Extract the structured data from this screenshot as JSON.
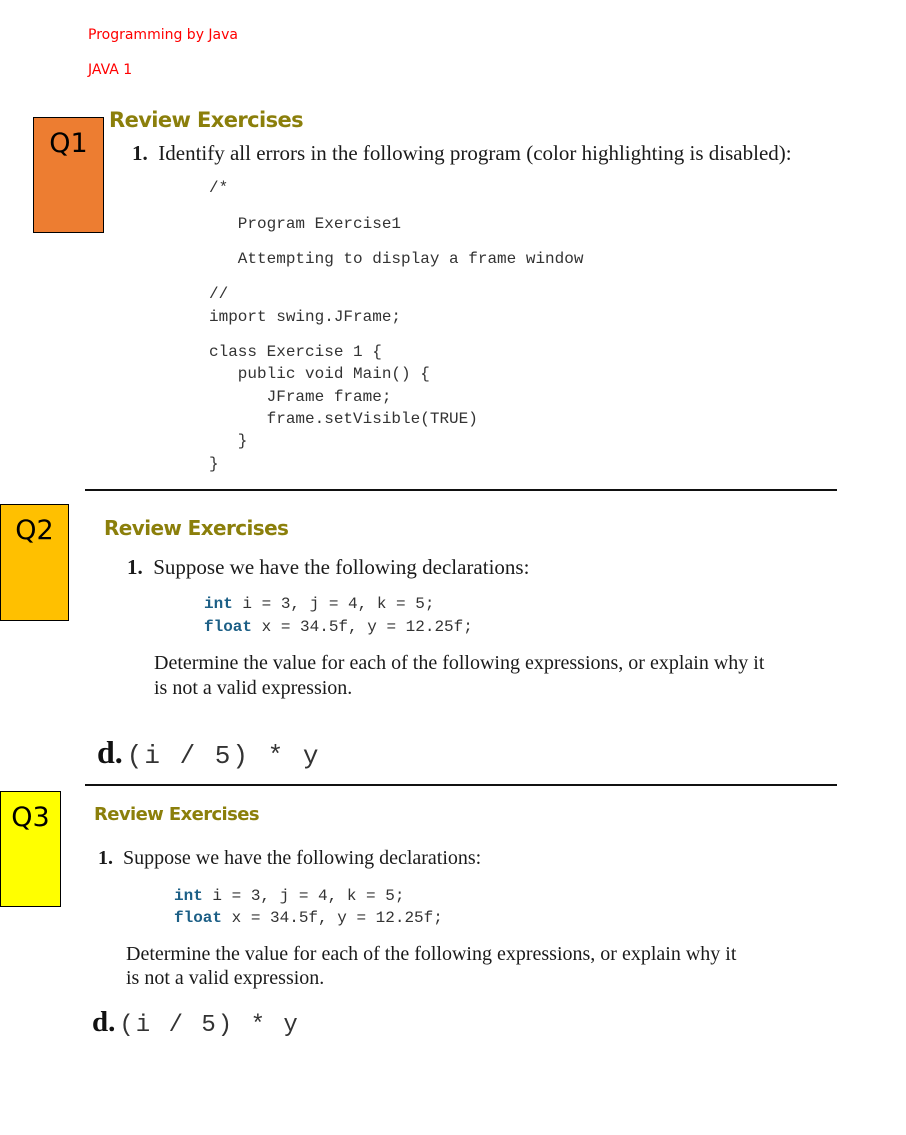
{
  "header": {
    "course": "Programming by Java",
    "unit": "JAVA 1"
  },
  "colors": {
    "q1_box": "#ED7D31",
    "q2_box": "#FFC000",
    "q3_box": "#FFFF00",
    "header_text": "#FF0000",
    "section_heading": "#8B7F0B",
    "keyword": "#1C5F86"
  },
  "q1": {
    "badge": "Q1",
    "heading": "Review Exercises",
    "number": "1.",
    "prompt": "Identify all errors in the following program (color highlighting is disabled):",
    "code": [
      "/*",
      "   Program Exercise1",
      "   Attempting to display a frame window",
      "//",
      "import swing.JFrame;",
      "class Exercise 1 {",
      "   public void Main() {",
      "      JFrame frame;",
      "      frame.setVisible(TRUE)",
      "   }",
      "}"
    ]
  },
  "q2": {
    "badge": "Q2",
    "heading": "Review Exercises",
    "number": "1.",
    "prompt": "Suppose we have the following declarations:",
    "decl_int_kw": "int",
    "decl_int_rest": " i = 3, j = 4, k = 5;",
    "decl_float_kw": "float",
    "decl_float_rest": " x = 34.5f, y = 12.25f;",
    "instruction_line1": "Determine the value for each of the following expressions, or explain why it",
    "instruction_line2": "is not a valid expression.",
    "part_label": "d.",
    "expression": "(i / 5) * y"
  },
  "q3": {
    "badge": "Q3",
    "heading": "Review Exercises",
    "number": "1.",
    "prompt": "Suppose we have the following declarations:",
    "decl_int_kw": "int",
    "decl_int_rest": " i = 3, j = 4, k = 5;",
    "decl_float_kw": "float",
    "decl_float_rest": " x = 34.5f, y = 12.25f;",
    "instruction_line1": "Determine the value for each of the following expressions, or explain why it",
    "instruction_line2": "is not a valid expression.",
    "part_label": "d.",
    "expression": "(i / 5) * y"
  }
}
